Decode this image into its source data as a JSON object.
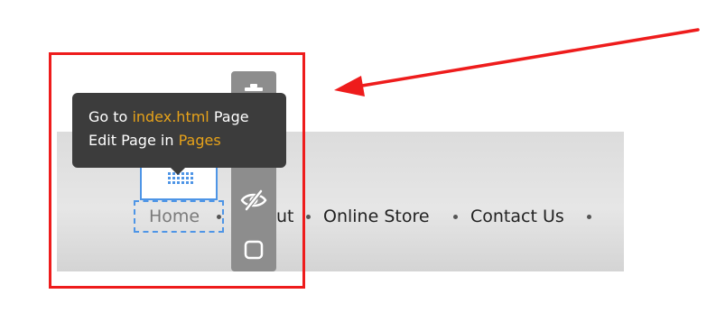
{
  "menu": {
    "items": [
      {
        "label": "Home"
      },
      {
        "label": "ut"
      },
      {
        "label": "Online Store"
      },
      {
        "label": "Contact Us"
      }
    ]
  },
  "tooltip": {
    "line1_prefix": "Go to",
    "line1_link": "index.html",
    "line1_suffix": "Page",
    "line2_prefix": "Edit Page in",
    "line2_link": "Pages"
  },
  "toolbar": {
    "buttons": [
      "delete-icon",
      "hide-icon",
      "frame-icon"
    ]
  },
  "colors": {
    "annotation_red": "#ee1c1c",
    "selection_blue": "#4e95e6",
    "tooltip_bg": "#3c3c3c",
    "tooltip_link": "#e6a21a",
    "toolbar_bg": "#8d8d8d"
  }
}
